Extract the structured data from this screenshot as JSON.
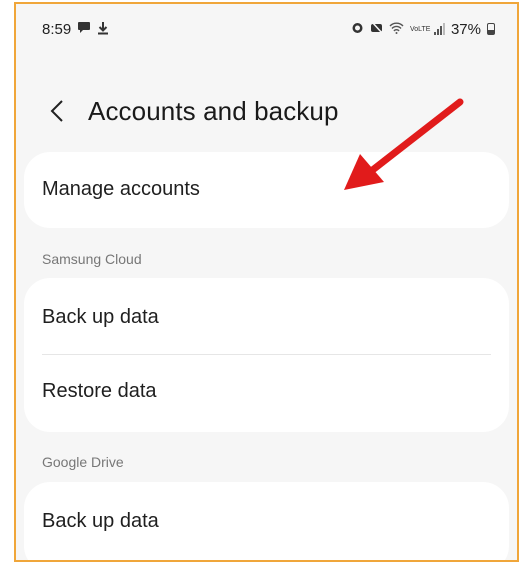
{
  "status_bar": {
    "time": "8:59",
    "battery": "37%",
    "left_icons": [
      "chat-icon",
      "download-icon"
    ],
    "right_icons": [
      "alarm-icon",
      "mute-icon",
      "wifi-icon",
      "volte-icon",
      "signal-icon",
      "battery-icon"
    ],
    "volte_text": "VoLTE"
  },
  "header": {
    "title": "Accounts and backup"
  },
  "sections": {
    "top": {
      "items": [
        "Manage accounts"
      ]
    },
    "samsung_cloud": {
      "label": "Samsung Cloud",
      "items": [
        "Back up data",
        "Restore data"
      ]
    },
    "google_drive": {
      "label": "Google Drive",
      "items": [
        "Back up data"
      ]
    }
  },
  "colors": {
    "frame_border": "#f0a63a",
    "annotation_arrow": "#e11b1b",
    "background": "#f6f6f6",
    "card": "#ffffff"
  }
}
